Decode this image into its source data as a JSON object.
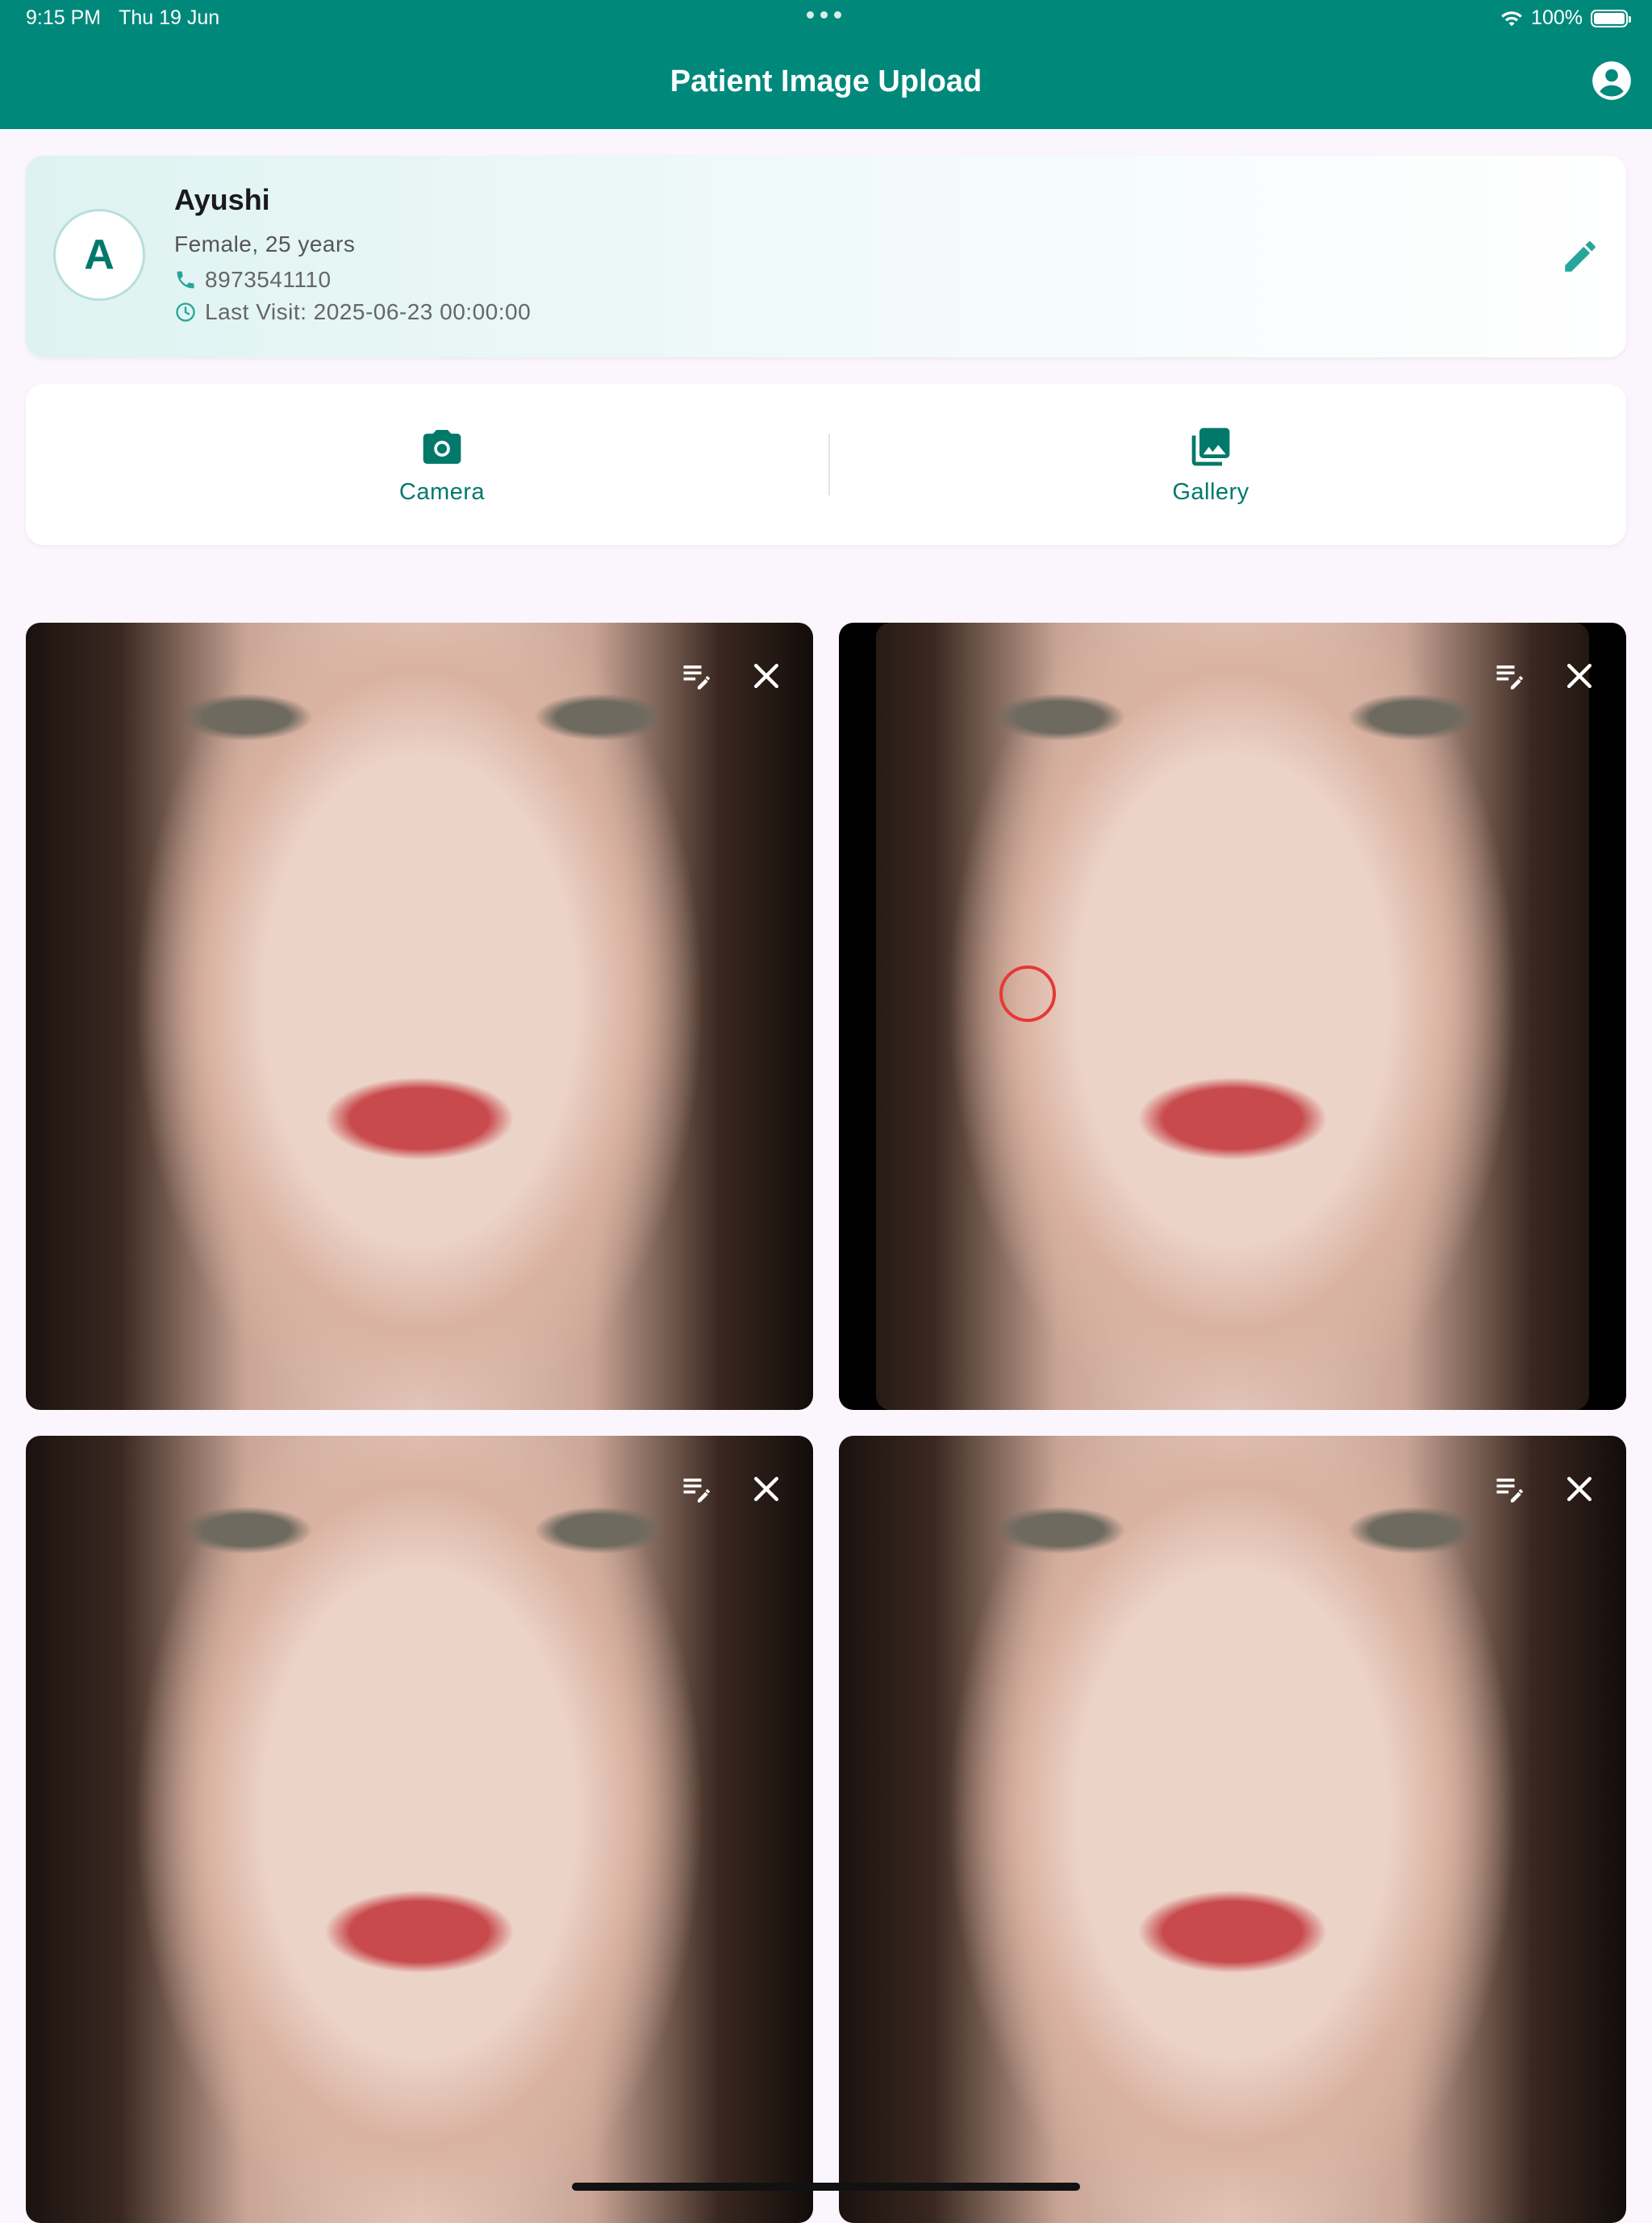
{
  "status": {
    "time": "9:15 PM",
    "date": "Thu 19 Jun",
    "battery": "100%"
  },
  "header": {
    "title": "Patient Image Upload"
  },
  "patient": {
    "initial": "A",
    "name": "Ayushi",
    "details": "Female, 25 years",
    "phone": "8973541110",
    "last_visit": "Last Visit: 2025-06-23 00:00:00"
  },
  "actions": {
    "camera": "Camera",
    "gallery": "Gallery"
  },
  "colors": {
    "primary": "#00897b",
    "accent_text": "#00796b",
    "marker": "#e53935",
    "background": "#fbf6fd"
  },
  "icons": [
    "wifi-icon",
    "battery-icon",
    "account-circle-icon",
    "pencil-icon",
    "phone-icon",
    "clock-icon",
    "camera-icon",
    "gallery-icon",
    "edit-notes-icon",
    "close-icon"
  ]
}
